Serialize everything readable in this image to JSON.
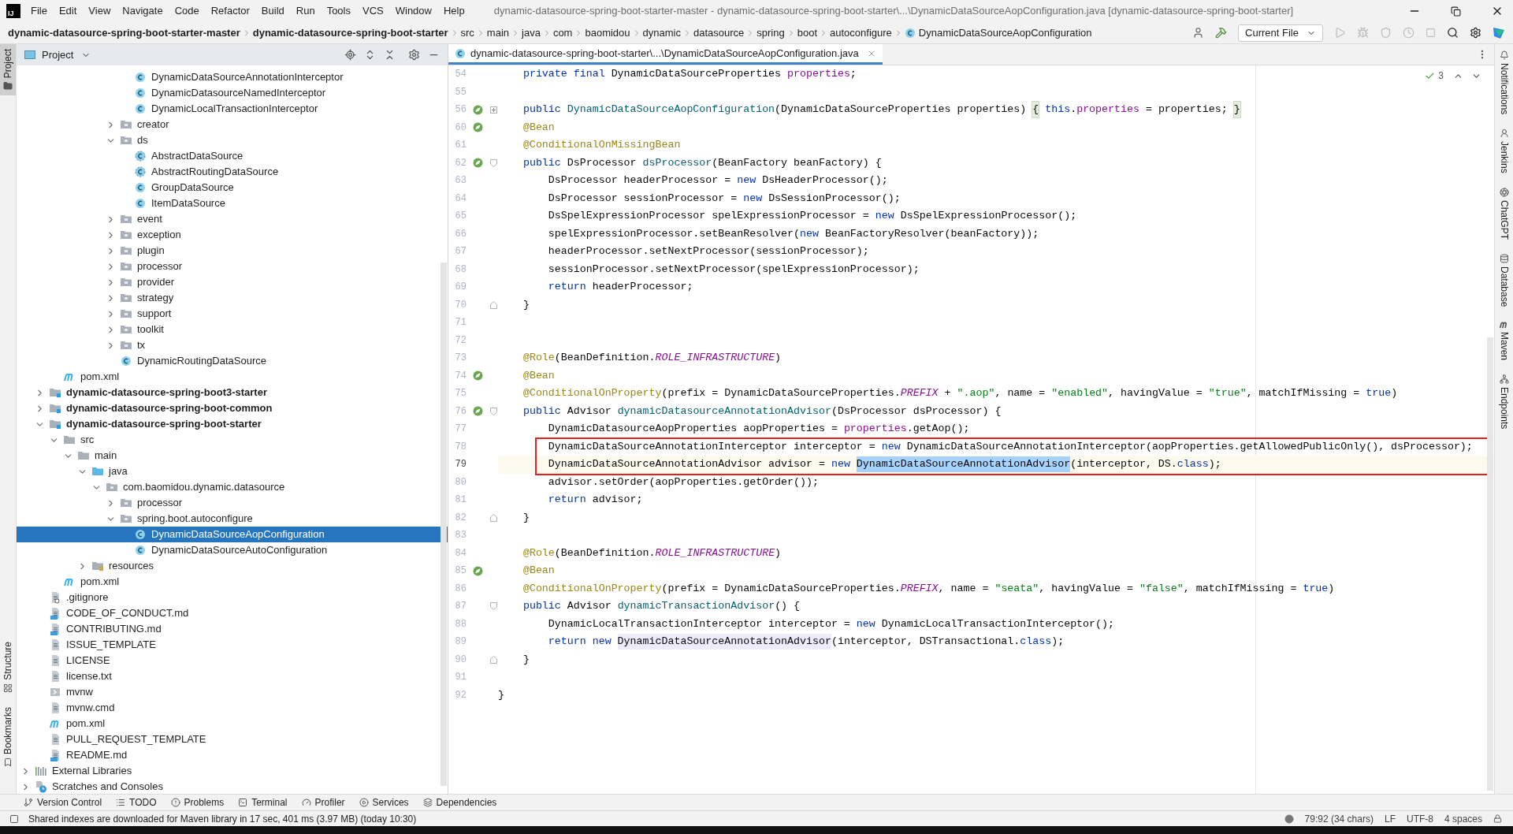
{
  "menu_bar": {
    "logo": "IJ",
    "items": [
      "File",
      "Edit",
      "View",
      "Navigate",
      "Code",
      "Refactor",
      "Build",
      "Run",
      "Tools",
      "VCS",
      "Window",
      "Help"
    ],
    "title": "dynamic-datasource-spring-boot-starter-master - dynamic-datasource-spring-boot-starter\\...\\DynamicDataSourceAopConfiguration.java [dynamic-datasource-spring-boot-starter]"
  },
  "breadcrumbs": [
    {
      "label": "dynamic-datasource-spring-boot-starter-master",
      "kind": "module"
    },
    {
      "label": "dynamic-datasource-spring-boot-starter",
      "kind": "module"
    },
    {
      "label": "src",
      "kind": "folder"
    },
    {
      "label": "main",
      "kind": "folder"
    },
    {
      "label": "java",
      "kind": "folder"
    },
    {
      "label": "com",
      "kind": "folder"
    },
    {
      "label": "baomidou",
      "kind": "folder"
    },
    {
      "label": "dynamic",
      "kind": "folder"
    },
    {
      "label": "datasource",
      "kind": "folder"
    },
    {
      "label": "spring",
      "kind": "folder"
    },
    {
      "label": "boot",
      "kind": "folder"
    },
    {
      "label": "autoconfigure",
      "kind": "folder"
    },
    {
      "label": "DynamicDataSourceAopConfiguration",
      "kind": "class"
    }
  ],
  "run_config": "Current File",
  "left_stripe": {
    "top": [
      {
        "label": "Project",
        "selected": true
      }
    ],
    "bottom": [
      {
        "label": "Structure",
        "selected": false
      },
      {
        "label": "Bookmarks",
        "selected": false
      }
    ]
  },
  "right_stripe": [
    {
      "label": "Notifications",
      "selected": false
    },
    {
      "label": "Jenkins",
      "selected": false
    },
    {
      "label": "ChatGPT",
      "selected": false
    },
    {
      "label": "Database",
      "selected": false
    },
    {
      "label": "Maven",
      "selected": false
    },
    {
      "label": "Endpoints",
      "selected": false
    }
  ],
  "project_panel": {
    "title": "Project",
    "tree": [
      {
        "children": [
          {
            "children": [
              {
                "children": [
                  {
                    "children": [
                      {
                        "children": [
                          {
                            "children": [
                              {
                                "children": [
                                  {
                                    "label": "DynamicDataSourceAnnotationInterceptor",
                                    "kind": "class",
                                    "selected": false
                                  },
                                  {
                                    "label": "DynamicDatasourceNamedInterceptor",
                                    "kind": "class",
                                    "selected": false
                                  },
                                  {
                                    "label": "DynamicLocalTransactionInterceptor",
                                    "kind": "class",
                                    "selected": false
                                  }
                                ]
                              },
                              {
                                "label": "creator",
                                "kind": "package",
                                "expanded": false,
                                "selected": false
                              },
                              {
                                "label": "ds",
                                "kind": "package",
                                "expanded": true,
                                "selected": false,
                                "children": [
                                  {
                                    "label": "AbstractDataSource",
                                    "kind": "abstract_class",
                                    "selected": false
                                  },
                                  {
                                    "label": "AbstractRoutingDataSource",
                                    "kind": "abstract_class",
                                    "selected": false
                                  },
                                  {
                                    "label": "GroupDataSource",
                                    "kind": "class",
                                    "selected": false
                                  },
                                  {
                                    "label": "ItemDataSource",
                                    "kind": "class",
                                    "selected": false
                                  }
                                ]
                              },
                              {
                                "label": "event",
                                "kind": "package",
                                "expanded": false,
                                "selected": false
                              },
                              {
                                "label": "exception",
                                "kind": "package",
                                "expanded": false,
                                "selected": false
                              },
                              {
                                "label": "plugin",
                                "kind": "package",
                                "expanded": false,
                                "selected": false
                              },
                              {
                                "label": "processor",
                                "kind": "package",
                                "expanded": false,
                                "selected": false
                              },
                              {
                                "label": "provider",
                                "kind": "package",
                                "expanded": false,
                                "selected": false
                              },
                              {
                                "label": "strategy",
                                "kind": "package",
                                "expanded": false,
                                "selected": false
                              },
                              {
                                "label": "support",
                                "kind": "package",
                                "expanded": false,
                                "selected": false
                              },
                              {
                                "label": "toolkit",
                                "kind": "package",
                                "expanded": false,
                                "selected": false
                              },
                              {
                                "label": "tx",
                                "kind": "package",
                                "expanded": false,
                                "selected": false
                              },
                              {
                                "label": "DynamicRoutingDataSource",
                                "kind": "class",
                                "selected": false
                              }
                            ]
                          }
                        ]
                      }
                    ]
                  }
                ]
              },
              {
                "label": "pom.xml",
                "kind": "maven",
                "selected": false
              }
            ]
          },
          {
            "label": "dynamic-datasource-spring-boot3-starter",
            "kind": "module",
            "expanded": false,
            "selected": false
          },
          {
            "label": "dynamic-datasource-spring-boot-common",
            "kind": "module",
            "expanded": false,
            "selected": false
          },
          {
            "label": "dynamic-datasource-spring-boot-starter",
            "kind": "module",
            "expanded": true,
            "selected": false,
            "children": [
              {
                "label": "src",
                "kind": "folder",
                "expanded": true,
                "selected": false,
                "children": [
                  {
                    "label": "main",
                    "kind": "folder",
                    "expanded": true,
                    "selected": false,
                    "children": [
                      {
                        "label": "java",
                        "kind": "source_root",
                        "expanded": true,
                        "selected": false,
                        "children": [
                          {
                            "label": "com.baomidou.dynamic.datasource",
                            "kind": "package",
                            "expanded": true,
                            "selected": false,
                            "children": [
                              {
                                "label": "processor",
                                "kind": "package",
                                "expanded": false,
                                "selected": false
                              },
                              {
                                "label": "spring.boot.autoconfigure",
                                "kind": "package",
                                "expanded": true,
                                "selected": false,
                                "children": [
                                  {
                                    "label": "DynamicDataSourceAopConfiguration",
                                    "kind": "class",
                                    "selected": true
                                  },
                                  {
                                    "label": "DynamicDataSourceAutoConfiguration",
                                    "kind": "class",
                                    "selected": false
                                  }
                                ]
                              }
                            ]
                          }
                        ]
                      },
                      {
                        "label": "resources",
                        "kind": "resources",
                        "expanded": false,
                        "selected": false
                      }
                    ]
                  }
                ]
              },
              {
                "label": "pom.xml",
                "kind": "maven",
                "selected": false
              }
            ]
          },
          {
            "label": ".gitignore",
            "kind": "gitignore",
            "selected": false
          },
          {
            "label": "CODE_OF_CONDUCT.md",
            "kind": "markdown",
            "selected": false
          },
          {
            "label": "CONTRIBUTING.md",
            "kind": "markdown",
            "selected": false
          },
          {
            "label": "ISSUE_TEMPLATE",
            "kind": "text",
            "selected": false
          },
          {
            "label": "LICENSE",
            "kind": "text",
            "selected": false
          },
          {
            "label": "license.txt",
            "kind": "text",
            "selected": false
          },
          {
            "label": "mvnw",
            "kind": "script",
            "selected": false
          },
          {
            "label": "mvnw.cmd",
            "kind": "text",
            "selected": false
          },
          {
            "label": "pom.xml",
            "kind": "maven",
            "selected": false
          },
          {
            "label": "PULL_REQUEST_TEMPLATE",
            "kind": "text",
            "selected": false
          },
          {
            "label": "README.md",
            "kind": "markdown",
            "selected": false
          }
        ]
      },
      {
        "label": "External Libraries",
        "kind": "libraries",
        "expanded": false,
        "selected": false
      },
      {
        "label": "Scratches and Consoles",
        "kind": "scratches",
        "expanded": false,
        "selected": false
      }
    ]
  },
  "editor": {
    "tab": {
      "label": "dynamic-datasource-spring-boot-starter\\...\\DynamicDataSourceAopConfiguration.java",
      "selected": true
    },
    "inspections": "3",
    "lines": [
      {
        "number": "54",
        "current": false,
        "boxed": false,
        "tokens": [
          {
            "kind": "keyword",
            "text": "    private final"
          },
          {
            "kind": "plain",
            "text": " DynamicDataSourceProperties "
          },
          {
            "kind": "field",
            "text": "properties"
          },
          {
            "kind": "plain",
            "text": ";"
          }
        ]
      },
      {
        "number": "55",
        "current": false,
        "boxed": false
      },
      {
        "number": "56",
        "current": false,
        "boxed": false,
        "gutter": {
          "kind": "bean"
        },
        "fold": {
          "kind": "collapsed"
        },
        "tokens": [
          {
            "kind": "keyword",
            "text": "    public"
          },
          {
            "kind": "method",
            "text": " DynamicDataSourceAopConfiguration"
          },
          {
            "kind": "plain",
            "text": "(DynamicDataSourceProperties properties) "
          },
          {
            "kind": "fold",
            "text": "{"
          },
          {
            "kind": "keyword",
            "text": " this"
          },
          {
            "kind": "plain",
            "text": "."
          },
          {
            "kind": "field",
            "text": "properties"
          },
          {
            "kind": "plain",
            "text": " = properties; "
          },
          {
            "kind": "fold",
            "text": "}"
          }
        ]
      },
      {
        "number": "60",
        "current": false,
        "boxed": false,
        "gutter": {
          "kind": "bean"
        },
        "tokens": [
          {
            "kind": "annotation",
            "text": "    @Bean"
          }
        ]
      },
      {
        "number": "61",
        "current": false,
        "boxed": false,
        "tokens": [
          {
            "kind": "annotation",
            "text": "    @ConditionalOnMissingBean"
          }
        ]
      },
      {
        "number": "62",
        "current": false,
        "boxed": false,
        "gutter": {
          "kind": "bean"
        },
        "fold": {
          "kind": "start"
        },
        "tokens": [
          {
            "kind": "keyword",
            "text": "    public"
          },
          {
            "kind": "plain",
            "text": " DsProcessor "
          },
          {
            "kind": "method",
            "text": "dsProcessor"
          },
          {
            "kind": "plain",
            "text": "(BeanFactory beanFactory) {"
          }
        ]
      },
      {
        "number": "63",
        "current": false,
        "boxed": false,
        "tokens": [
          {
            "kind": "plain",
            "text": "        DsProcessor headerProcessor = "
          },
          {
            "kind": "keyword",
            "text": "new"
          },
          {
            "kind": "plain",
            "text": " DsHeaderProcessor();"
          }
        ]
      },
      {
        "number": "64",
        "current": false,
        "boxed": false,
        "tokens": [
          {
            "kind": "plain",
            "text": "        DsProcessor sessionProcessor = "
          },
          {
            "kind": "keyword",
            "text": "new"
          },
          {
            "kind": "plain",
            "text": " DsSessionProcessor();"
          }
        ]
      },
      {
        "number": "65",
        "current": false,
        "boxed": false,
        "tokens": [
          {
            "kind": "plain",
            "text": "        DsSpelExpressionProcessor spelExpressionProcessor = "
          },
          {
            "kind": "keyword",
            "text": "new"
          },
          {
            "kind": "plain",
            "text": " DsSpelExpressionProcessor();"
          }
        ]
      },
      {
        "number": "66",
        "current": false,
        "boxed": false,
        "tokens": [
          {
            "kind": "plain",
            "text": "        spelExpressionProcessor.setBeanResolver("
          },
          {
            "kind": "keyword",
            "text": "new"
          },
          {
            "kind": "plain",
            "text": " BeanFactoryResolver(beanFactory));"
          }
        ]
      },
      {
        "number": "67",
        "current": false,
        "boxed": false,
        "tokens": [
          {
            "kind": "plain",
            "text": "        headerProcessor.setNextProcessor(sessionProcessor);"
          }
        ]
      },
      {
        "number": "68",
        "current": false,
        "boxed": false,
        "tokens": [
          {
            "kind": "plain",
            "text": "        sessionProcessor.setNextProcessor(spelExpressionProcessor);"
          }
        ]
      },
      {
        "number": "69",
        "current": false,
        "boxed": false,
        "tokens": [
          {
            "kind": "keyword",
            "text": "        return"
          },
          {
            "kind": "plain",
            "text": " headerProcessor;"
          }
        ]
      },
      {
        "number": "70",
        "current": false,
        "boxed": false,
        "fold": {
          "kind": "end"
        },
        "tokens": [
          {
            "kind": "plain",
            "text": "    }"
          }
        ]
      },
      {
        "number": "71",
        "current": false,
        "boxed": false
      },
      {
        "number": "72",
        "current": false,
        "boxed": false
      },
      {
        "number": "73",
        "current": false,
        "boxed": false,
        "tokens": [
          {
            "kind": "annotation",
            "text": "    @Role"
          },
          {
            "kind": "plain",
            "text": "(BeanDefinition."
          },
          {
            "kind": "constant",
            "text": "ROLE_INFRASTRUCTURE"
          },
          {
            "kind": "plain",
            "text": ")"
          }
        ]
      },
      {
        "number": "74",
        "current": false,
        "boxed": false,
        "gutter": {
          "kind": "bean"
        },
        "tokens": [
          {
            "kind": "annotation",
            "text": "    @Bean"
          }
        ]
      },
      {
        "number": "75",
        "current": false,
        "boxed": false,
        "tokens": [
          {
            "kind": "annotation",
            "text": "    @ConditionalOnProperty"
          },
          {
            "kind": "plain",
            "text": "(prefix = DynamicDataSourceProperties."
          },
          {
            "kind": "constant",
            "text": "PREFIX"
          },
          {
            "kind": "plain",
            "text": " + "
          },
          {
            "kind": "string",
            "text": "\".aop\""
          },
          {
            "kind": "plain",
            "text": ", name = "
          },
          {
            "kind": "string",
            "text": "\"enabled\""
          },
          {
            "kind": "plain",
            "text": ", havingValue = "
          },
          {
            "kind": "string",
            "text": "\"true\""
          },
          {
            "kind": "plain",
            "text": ", matchIfMissing = "
          },
          {
            "kind": "keyword",
            "text": "true"
          },
          {
            "kind": "plain",
            "text": ")"
          }
        ]
      },
      {
        "number": "76",
        "current": false,
        "boxed": false,
        "gutter": {
          "kind": "bean"
        },
        "fold": {
          "kind": "start"
        },
        "tokens": [
          {
            "kind": "keyword",
            "text": "    public"
          },
          {
            "kind": "plain",
            "text": " Advisor "
          },
          {
            "kind": "method",
            "text": "dynamicDatasourceAnnotationAdvisor"
          },
          {
            "kind": "plain",
            "text": "(DsProcessor dsProcessor) {"
          }
        ]
      },
      {
        "number": "77",
        "current": false,
        "boxed": false,
        "tokens": [
          {
            "kind": "plain",
            "text": "        DynamicDatasourceAopProperties aopProperties = "
          },
          {
            "kind": "field",
            "text": "properties"
          },
          {
            "kind": "plain",
            "text": ".getAop();"
          }
        ]
      },
      {
        "number": "78",
        "current": false,
        "boxed": true,
        "tokens": [
          {
            "kind": "plain",
            "text": "        DynamicDataSourceAnnotationInterceptor interceptor = "
          },
          {
            "kind": "keyword",
            "text": "new"
          },
          {
            "kind": "plain",
            "text": " DynamicDataSourceAnnotationInterceptor(aopProperties.getAllowedPublicOnly(), dsProcessor);"
          }
        ]
      },
      {
        "number": "79",
        "current": true,
        "boxed": true,
        "tokens": [
          {
            "kind": "plain",
            "text": "        DynamicDataSourceAnnotationAdvisor advisor = "
          },
          {
            "kind": "keyword",
            "text": "new "
          },
          {
            "kind": "selection",
            "text": "DynamicDataSourceAnnotationAdvisor"
          },
          {
            "kind": "plain",
            "text": "(interceptor, DS."
          },
          {
            "kind": "keyword",
            "text": "class"
          },
          {
            "kind": "plain",
            "text": ");"
          }
        ]
      },
      {
        "number": "80",
        "current": false,
        "boxed": false,
        "tokens": [
          {
            "kind": "plain",
            "text": "        advisor.setOrder(aopProperties.getOrder());"
          }
        ]
      },
      {
        "number": "81",
        "current": false,
        "boxed": false,
        "tokens": [
          {
            "kind": "keyword",
            "text": "        return"
          },
          {
            "kind": "plain",
            "text": " advisor;"
          }
        ]
      },
      {
        "number": "82",
        "current": false,
        "boxed": false,
        "fold": {
          "kind": "end"
        },
        "tokens": [
          {
            "kind": "plain",
            "text": "    }"
          }
        ]
      },
      {
        "number": "83",
        "current": false,
        "boxed": false
      },
      {
        "number": "84",
        "current": false,
        "boxed": false,
        "tokens": [
          {
            "kind": "annotation",
            "text": "    @Role"
          },
          {
            "kind": "plain",
            "text": "(BeanDefinition."
          },
          {
            "kind": "constant",
            "text": "ROLE_INFRASTRUCTURE"
          },
          {
            "kind": "plain",
            "text": ")"
          }
        ]
      },
      {
        "number": "85",
        "current": false,
        "boxed": false,
        "gutter": {
          "kind": "bean"
        },
        "tokens": [
          {
            "kind": "annotation",
            "text": "    @Bean"
          }
        ]
      },
      {
        "number": "86",
        "current": false,
        "boxed": false,
        "tokens": [
          {
            "kind": "annotation",
            "text": "    @ConditionalOnProperty"
          },
          {
            "kind": "plain",
            "text": "(prefix = DynamicDataSourceProperties."
          },
          {
            "kind": "constant",
            "text": "PREFIX"
          },
          {
            "kind": "plain",
            "text": ", name = "
          },
          {
            "kind": "string",
            "text": "\"seata\""
          },
          {
            "kind": "plain",
            "text": ", havingValue = "
          },
          {
            "kind": "string",
            "text": "\"false\""
          },
          {
            "kind": "plain",
            "text": ", matchIfMissing = "
          },
          {
            "kind": "keyword",
            "text": "true"
          },
          {
            "kind": "plain",
            "text": ")"
          }
        ]
      },
      {
        "number": "87",
        "current": false,
        "boxed": false,
        "fold": {
          "kind": "start"
        },
        "tokens": [
          {
            "kind": "keyword",
            "text": "    public"
          },
          {
            "kind": "plain",
            "text": " Advisor "
          },
          {
            "kind": "method",
            "text": "dynamicTransactionAdvisor"
          },
          {
            "kind": "plain",
            "text": "() {"
          }
        ]
      },
      {
        "number": "88",
        "current": false,
        "boxed": false,
        "tokens": [
          {
            "kind": "plain",
            "text": "        DynamicLocalTransactionInterceptor interceptor = "
          },
          {
            "kind": "keyword",
            "text": "new"
          },
          {
            "kind": "plain",
            "text": " DynamicLocalTransactionInterceptor();"
          }
        ]
      },
      {
        "number": "89",
        "current": false,
        "boxed": false,
        "tokens": [
          {
            "kind": "keyword",
            "text": "        return new "
          },
          {
            "kind": "usage",
            "text": "DynamicDataSourceAnnotationAdvisor"
          },
          {
            "kind": "plain",
            "text": "(interceptor, DSTransactional."
          },
          {
            "kind": "keyword",
            "text": "class"
          },
          {
            "kind": "plain",
            "text": ");"
          }
        ]
      },
      {
        "number": "90",
        "current": false,
        "boxed": false,
        "fold": {
          "kind": "end"
        },
        "tokens": [
          {
            "kind": "plain",
            "text": "    }"
          }
        ]
      },
      {
        "number": "91",
        "current": false,
        "boxed": false
      },
      {
        "number": "92",
        "current": false,
        "boxed": false,
        "tokens": [
          {
            "kind": "plain",
            "text": "}"
          }
        ]
      }
    ]
  },
  "tool_windows": [
    "Version Control",
    "TODO",
    "Problems",
    "Terminal",
    "Profiler",
    "Services",
    "Dependencies"
  ],
  "status_bar": {
    "message": "Shared indexes are downloaded for Maven library in 17 sec, 401 ms (3.97 MB) (today 10:30)",
    "position": "79:92 (34 chars)",
    "line_separator": "LF",
    "encoding": "UTF-8",
    "indent": "4 spaces"
  }
}
